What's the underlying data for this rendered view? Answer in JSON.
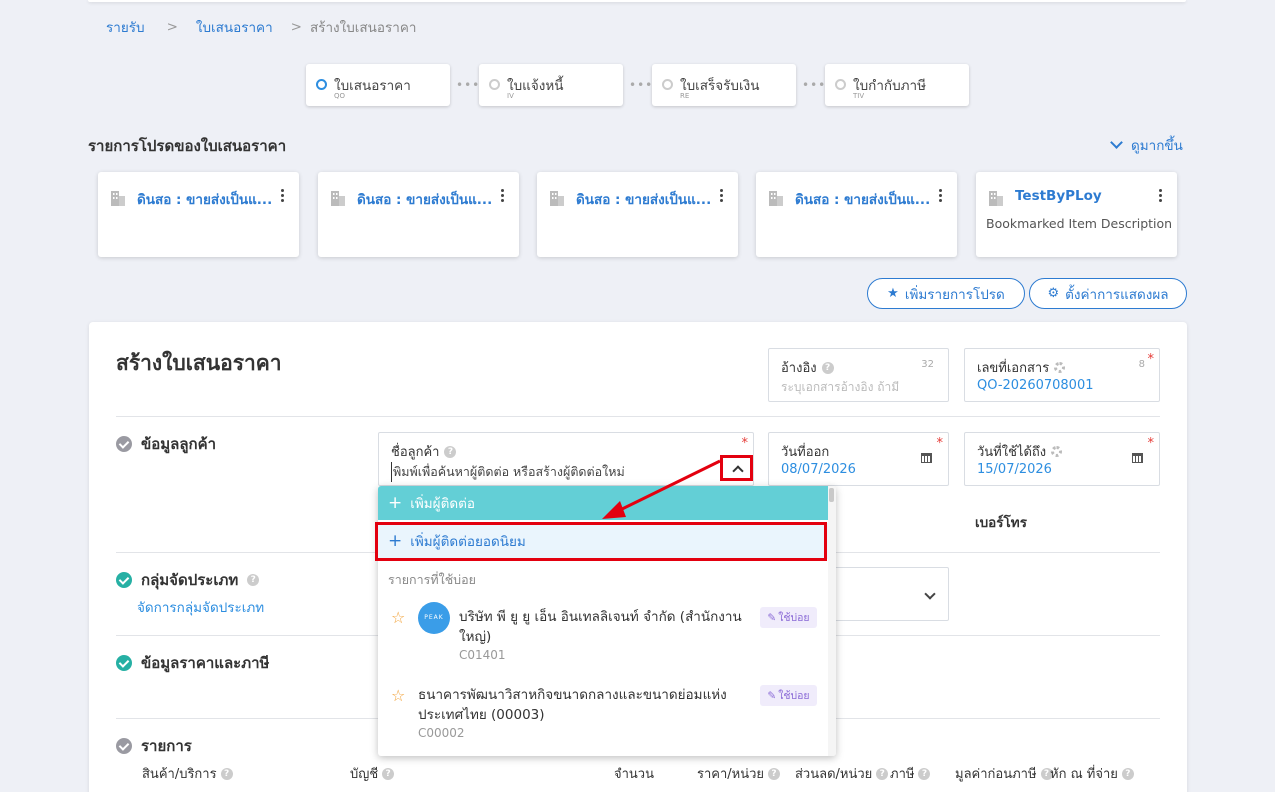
{
  "breadcrumb": {
    "item1": "รายรับ",
    "item2": "ใบเสนอราคา",
    "current": "สร้างใบเสนอราคา",
    "sep": ">"
  },
  "steps": [
    {
      "label": "ใบเสนอราคา",
      "code": "QO"
    },
    {
      "label": "ใบแจ้งหนี้",
      "code": "IV"
    },
    {
      "label": "ใบเสร็จรับเงิน",
      "code": "RE"
    },
    {
      "label": "ใบกำกับภาษี",
      "code": "TIV"
    }
  ],
  "favorites": {
    "title": "รายการโปรดของใบเสนอราคา",
    "see_more": "ดูมากขึ้น",
    "cards": [
      {
        "title": "ดินสอ : ขายส่งเป็นแ...",
        "desc": ""
      },
      {
        "title": "ดินสอ : ขายส่งเป็นแ...",
        "desc": ""
      },
      {
        "title": "ดินสอ : ขายส่งเป็นแ...",
        "desc": ""
      },
      {
        "title": "ดินสอ : ขายส่งเป็นแ...",
        "desc": ""
      },
      {
        "title": "TestByPLoy",
        "desc": "Bookmarked Item Description"
      }
    ],
    "add_button": "เพิ่มรายการโปรด",
    "settings_button": "ตั้งค่าการแสดงผล"
  },
  "form": {
    "title": "สร้างใบเสนอราคา",
    "reference": {
      "label": "อ้างอิง",
      "count": "32",
      "placeholder": "ระบุเอกสารอ้างอิง ถ้ามี"
    },
    "doc_no": {
      "label": "เลขที่เอกสาร",
      "count": "8",
      "value": "QO-20260708001"
    },
    "customer_section": "ข้อมูลลูกค้า",
    "customer_name": {
      "label": "ชื่อลูกค้า",
      "placeholder": "พิมพ์เพื่อค้นหาผู้ติดต่อ หรือสร้างผู้ติดต่อใหม่"
    },
    "issue_date": {
      "label": "วันที่ออก",
      "value": "08/07/2026"
    },
    "valid_until": {
      "label": "วันที่ใช้ได้ถึง",
      "value": "15/07/2026"
    },
    "phone_label": "เบอร์โทร",
    "category_section": "กลุ่มจัดประเภท",
    "category_link": "จัดการกลุ่มจัดประเภท",
    "price_section": "ข้อมูลราคาและภาษี",
    "items_section": "รายการ",
    "required_mark": "*",
    "help_mark": "?",
    "columns": [
      "สินค้า/บริการ",
      "บัญชี",
      "จำนวน",
      "ราคา/หน่วย",
      "ส่วนลด/หน่วย",
      "ภาษี",
      "มูลค่าก่อนภาษี",
      "หัก ณ ที่จ่าย"
    ]
  },
  "dropdown": {
    "add_contact": "เพิ่มผู้ติดต่อ",
    "add_popular_contact": "เพิ่มผู้ติดต่อยอดนิยม",
    "frequent_header": "รายการที่ใช้บ่อย",
    "badge": "ใช้บ่อย",
    "logo_text": "PEAK",
    "items": [
      {
        "name_line1": "บริษัท พี ยู ยู เอ็น อินเทลลิเจนท์ จำกัด (สำนักงาน",
        "name_line2": "ใหญ่)",
        "code": "C01401"
      },
      {
        "name_line1": "ธนาคารพัฒนาวิสาหกิจขนาดกลางและขนาดย่อมแห่ง",
        "name_line2": "ประเทศไทย (00003)",
        "code": "C00002"
      }
    ]
  },
  "colors": {
    "accent": "#2d7bd1",
    "teal": "#63cfd6",
    "highlight": "#e3000f",
    "check": "#26b0a4"
  }
}
